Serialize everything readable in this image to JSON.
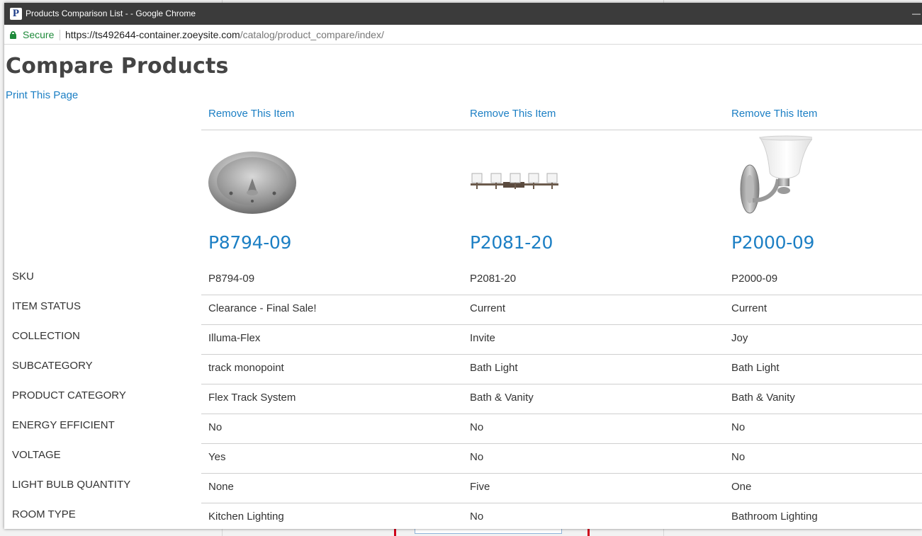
{
  "browser": {
    "window_title": "Products Comparison List - - Google Chrome",
    "favicon_text": "P",
    "minimize_glyph": "—",
    "security_label": "Secure",
    "url_scheme": "https://",
    "url_host": "ts492644-container.zoeysite.com",
    "url_path": "/catalog/product_compare/index/"
  },
  "page": {
    "title": "Compare Products",
    "print_link": "Print This Page"
  },
  "products": [
    {
      "remove_label": "Remove This Item",
      "name": "P8794-09",
      "image_icon": "canopy-fixture-image"
    },
    {
      "remove_label": "Remove This Item",
      "name": "P2081-20",
      "image_icon": "vanity-light-image"
    },
    {
      "remove_label": "Remove This Item",
      "name": "P2000-09",
      "image_icon": "wall-sconce-image"
    }
  ],
  "attributes": [
    {
      "label": "SKU",
      "values": [
        "P8794-09",
        "P2081-20",
        "P2000-09"
      ]
    },
    {
      "label": "ITEM STATUS",
      "values": [
        "Clearance - Final Sale!",
        "Current",
        "Current"
      ]
    },
    {
      "label": "COLLECTION",
      "values": [
        "Illuma-Flex",
        "Invite",
        "Joy"
      ]
    },
    {
      "label": "SUBCATEGORY",
      "values": [
        "track monopoint",
        "Bath Light",
        "Bath Light"
      ]
    },
    {
      "label": "PRODUCT CATEGORY",
      "values": [
        "Flex Track System",
        "Bath & Vanity",
        "Bath & Vanity"
      ]
    },
    {
      "label": "ENERGY EFFICIENT",
      "values": [
        "No",
        "No",
        "No"
      ]
    },
    {
      "label": "VOLTAGE",
      "values": [
        "Yes",
        "No",
        "No"
      ]
    },
    {
      "label": "LIGHT BULB QUANTITY",
      "values": [
        "None",
        "Five",
        "One"
      ]
    },
    {
      "label": "ROOM TYPE",
      "values": [
        "Kitchen Lighting",
        "No",
        "Bathroom Lighting"
      ]
    }
  ],
  "colors": {
    "link": "#1c7fc4",
    "titlebar": "#3b3b3b",
    "secure": "#1e8a3a",
    "text": "#333333"
  }
}
